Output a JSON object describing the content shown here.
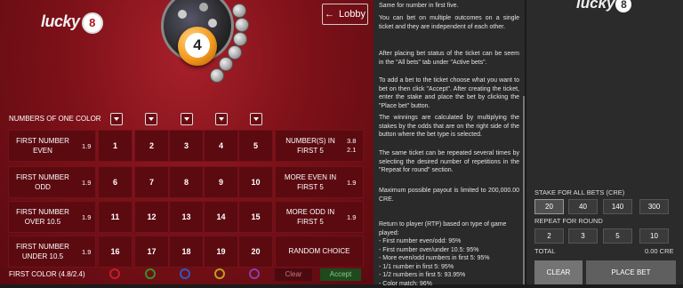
{
  "game": {
    "logo_text": "lucky",
    "logo_number": "8",
    "drawn_ball": "4",
    "lobby_label": "Lobby",
    "numbers_of_one_color_label": "NUMBERS OF ONE COLOR",
    "rows": [
      {
        "label": "FIRST NUMBER\nEVEN",
        "odd": "1.9",
        "numbers": [
          "1",
          "2",
          "3",
          "4",
          "5"
        ],
        "right_label": "NUMBER(S) IN\nFIRST 5",
        "right_odds": [
          "3.8",
          "2.1"
        ]
      },
      {
        "label": "FIRST NUMBER\nODD",
        "odd": "1.9",
        "numbers": [
          "6",
          "7",
          "8",
          "9",
          "10"
        ],
        "right_label": "MORE EVEN IN\nFIRST 5",
        "right_odds": [
          "1.9"
        ]
      },
      {
        "label": "FIRST NUMBER\nOVER 10.5",
        "odd": "1.9",
        "numbers": [
          "11",
          "12",
          "13",
          "14",
          "15"
        ],
        "right_label": "MORE ODD IN\nFIRST 5",
        "right_odds": [
          "1.9"
        ]
      },
      {
        "label": "FIRST NUMBER\nUNDER 10.5",
        "odd": "1.9",
        "numbers": [
          "16",
          "17",
          "18",
          "19",
          "20"
        ],
        "right_label": "RANDOM CHOICE",
        "right_odds": []
      }
    ],
    "first_color_label": "FIRST COLOR (4.8/2.4)",
    "clear_label": "Clear",
    "accept_label": "Accept",
    "first_color_rings": [
      "#c21f2a",
      "#3b8f2a",
      "#2c57c7",
      "#b9a21c",
      "#8a3ea8"
    ]
  },
  "help": {
    "paragraphs": [
      "Same for number in first five.",
      "You can bet on multiple outcomes on a single ticket and they are independent of each other.",
      "After placing bet status of the ticket can be seem in the \"All bets\" tab under \"Active bets\".",
      "To add a bet to the ticket choose what you want to bet on then click \"Accept\". After creating the ticket, enter the stake and place the bet by clicking the \"Place bet\" button.",
      "The winnings are calculated by multiplying the stakes by the odds that are on the right side of the button where the bet type is selected.",
      "The same ticket can be repeated several times by selecting the desired number of repetitions in the \"Repeat for round\" section.",
      "Maximum possible payout is limited to 200,000.00 CRE.",
      "Return to player (RTP) based on type of game played:\n- First number even/odd: 95%\n- First number over/under 10.5: 95%\n- More even/odd numbers in first 5: 95%\n- 1/1 number in first 5: 95%\n- 1/2 numbers in first 5: 93.95%\n- Color match: 96%"
    ]
  },
  "bet": {
    "logo_text": "lucky",
    "logo_number": "8",
    "stake_label": "STAKE FOR ALL BETS (CRE)",
    "stakes": [
      "20",
      "40",
      "140",
      "300"
    ],
    "repeat_label": "REPEAT FOR ROUND",
    "repeats": [
      "2",
      "3",
      "5",
      "10"
    ],
    "total_label": "TOTAL",
    "total_value": "0.00 CRE",
    "clear_label": "CLEAR",
    "place_label": "PLACE BET"
  }
}
